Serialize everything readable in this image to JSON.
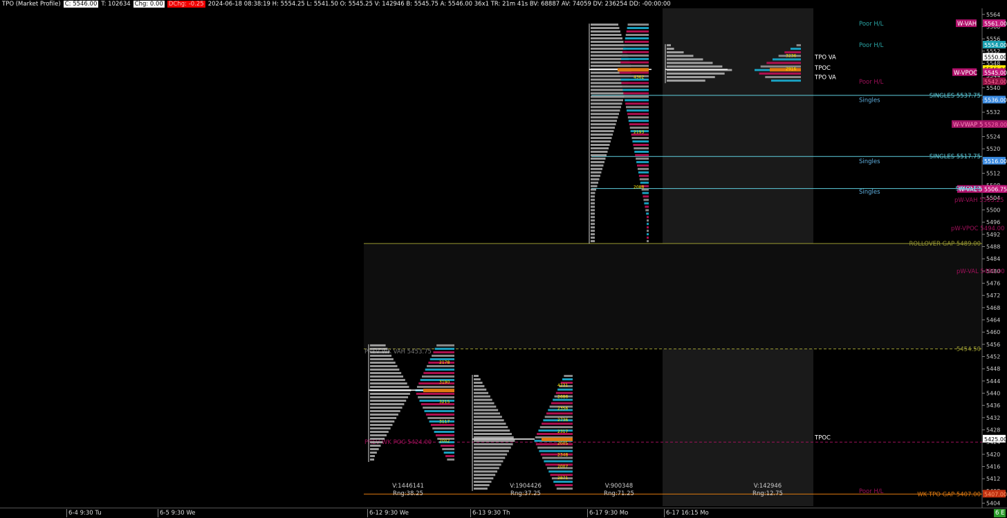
{
  "header": {
    "title": "TPO (Market Profile)",
    "close": "C: 5546.00",
    "ticks": "T: 102634",
    "chg": "Chg: 0.00",
    "dchg": "DChg: -0.25",
    "stats": "2024-06-18 08:38:19 H: 5554.25 L: 5541.50 O: 5545.25 V: 142946 B: 5545.75 A: 5546.00 36x1 TR: 21m 41s BV: 68887 AV: 74059 DV: 236254 DD: -00:00:00"
  },
  "x_axis": {
    "labels": [
      {
        "text": "6-4  9:30 Tu"
      },
      {
        "text": "6-5  9:30 We"
      },
      {
        "text": "6-12  9:30 We"
      },
      {
        "text": "6-13  9:30 Th"
      },
      {
        "text": "6-17  9:30 Mo"
      },
      {
        "text": "6-17  16:15 Mo"
      }
    ],
    "corner": "6 E"
  },
  "colors": {
    "background": "#000000",
    "cyan": "#5fd0e0",
    "magenta": "#c0187a",
    "olive": "#9a9a32",
    "orange": "#e07a10",
    "yellow": "#ffea00",
    "profile_gray": "#8a8a8a",
    "profile_teal": "#1aa0c0",
    "profile_maroon": "#b01050"
  },
  "chart_data": {
    "type": "table",
    "y_axis": {
      "range": [
        5403,
        5566
      ],
      "tick_step": 4,
      "ticks": [
        5564,
        5560,
        5556,
        5552,
        5548,
        5544,
        5540,
        5536,
        5532,
        5528,
        5524,
        5520,
        5516,
        5512,
        5508,
        5504,
        5500,
        5496,
        5492,
        5488,
        5484,
        5480,
        5476,
        5472,
        5468,
        5464,
        5460,
        5456,
        5452,
        5448,
        5444,
        5440,
        5436,
        5432,
        5428,
        5424,
        5420,
        5416,
        5412,
        5408,
        5404
      ]
    },
    "price_tags": [
      {
        "text": "5561.00",
        "price": 5561.0,
        "bg": "#c0187a",
        "fg": "#ffffff"
      },
      {
        "text": "5554.00",
        "price": 5554.0,
        "bg": "#1aa0b0",
        "fg": "#ffffff"
      },
      {
        "text": "5550.00",
        "price": 5550.0,
        "bg": "#ffffff",
        "fg": "#000000"
      },
      {
        "text": "5546.00",
        "price": 5546.0,
        "bg": "#ffea00",
        "fg": "#000000"
      },
      {
        "text": "5545.00",
        "price": 5545.0,
        "bg": "#c0187a",
        "fg": "#ffffff"
      },
      {
        "text": "5542.00",
        "price": 5542.0,
        "bg": "#8a1040",
        "fg": "#ff6a9a"
      },
      {
        "text": "5536.00",
        "price": 5536.0,
        "bg": "#3a8ae0",
        "fg": "#ffffff"
      },
      {
        "text": "5528.00",
        "price": 5528.0,
        "bg": "#a01464",
        "fg": "#ff6ab0"
      },
      {
        "text": "5516.00",
        "price": 5516.0,
        "bg": "#3a8ae0",
        "fg": "#ffffff"
      },
      {
        "text": "5506.75",
        "price": 5506.75,
        "bg": "#c0187a",
        "fg": "#ffffff"
      },
      {
        "text": "5425.00",
        "price": 5425.0,
        "bg": "#ffffff",
        "fg": "#000000"
      },
      {
        "text": "5407.00",
        "price": 5407.0,
        "bg": "#c03010",
        "fg": "#ff9a6a"
      }
    ],
    "levels": [
      {
        "label": "W-VAH",
        "value_text": "",
        "price": 5561.0,
        "color": "#e0189a",
        "label_bg": "#b0106a",
        "label_fg": "#ffffff",
        "style": "none"
      },
      {
        "label": "W-VPOC",
        "value_text": "",
        "price": 5545.0,
        "color": "#e0189a",
        "label_bg": "#b0106a",
        "label_fg": "#ffffff",
        "style": "none"
      },
      {
        "label": "W-VWAP",
        "value_text": "5528.00",
        "price": 5528.0,
        "color": "#e0189a",
        "label_bg": "#a01464",
        "label_fg": "#ff8ac0",
        "style": "none"
      },
      {
        "label": "W-VAL",
        "value_text": "5506.75",
        "price": 5506.75,
        "color": "#e0189a",
        "label_bg": "#b0106a",
        "label_fg": "#ffffff",
        "style": "none"
      },
      {
        "label": "pW-VAH",
        "value_text": "5503.25",
        "price": 5503.25,
        "color": "#a0105a",
        "label_bg": "",
        "label_fg": "#a0105a",
        "style": "none"
      },
      {
        "label": "pW-VPOC",
        "value_text": "5494.00",
        "price": 5494.0,
        "color": "#a0105a",
        "label_bg": "",
        "label_fg": "#a0105a",
        "style": "none"
      },
      {
        "label": "pW-VAL",
        "value_text": "5480.00",
        "price": 5480.0,
        "color": "#a0105a",
        "label_bg": "",
        "label_fg": "#a0105a",
        "style": "none"
      },
      {
        "label": "SINGLES",
        "value_text": "5537.75",
        "price": 5537.5,
        "color": "#5fd0e0",
        "label_bg": "",
        "label_fg": "#5fd0e0",
        "style": "solid"
      },
      {
        "label": "SINGLES",
        "value_text": "5517.75",
        "price": 5517.5,
        "color": "#5fd0e0",
        "label_bg": "",
        "label_fg": "#5fd0e0",
        "style": "solid"
      },
      {
        "label": "SINGLES",
        "value_text": "",
        "price": 5507.0,
        "color": "#5fd0e0",
        "label_bg": "",
        "label_fg": "#5fd0e0",
        "style": "solid"
      },
      {
        "label": "ROLLOVER GAP",
        "value_text": "5489.00",
        "price": 5489.0,
        "color": "#9a9a32",
        "label_bg": "",
        "label_fg": "#9a9a32",
        "style": "solid"
      },
      {
        "label": "",
        "value_text": "5454.50",
        "price": 5454.5,
        "color": "#9a9a32",
        "label_bg": "",
        "label_fg": "#9a9a32",
        "style": "dashed"
      },
      {
        "label": "WK TPO GAP",
        "value_text": "5407.00",
        "price": 5407.0,
        "color": "#e07a10",
        "label_bg": "",
        "label_fg": "#e07a10",
        "style": "solid"
      },
      {
        "label": "PREV WK VAH",
        "value_text": "5453.75",
        "price": 5453.75,
        "color": "#777777",
        "label_bg": "",
        "label_fg": "#777777",
        "style": "none"
      },
      {
        "label": "PREV WK POC",
        "value_text": "5424.00",
        "price": 5424.0,
        "color": "#a0105a",
        "label_bg": "",
        "label_fg": "#a0105a",
        "style": "dashed"
      }
    ],
    "annotations": [
      {
        "text": "Poor H/L",
        "price": 5561.0,
        "color": "#2aa5a5"
      },
      {
        "text": "Poor H/L",
        "price": 5554.0,
        "color": "#2aa5a5"
      },
      {
        "text": "Poor H/L",
        "price": 5542.0,
        "color": "#a0105a"
      },
      {
        "text": "Singles",
        "price": 5536.0,
        "color": "#5fb0e0"
      },
      {
        "text": "Singles",
        "price": 5516.0,
        "color": "#5fb0e0"
      },
      {
        "text": "Singles",
        "price": 5506.0,
        "color": "#5fb0e0"
      },
      {
        "text": "Poor H/L",
        "price": 5408.0,
        "color": "#a0105a"
      },
      {
        "text": "TPO VA",
        "price": 5550.0,
        "color": "#ffffff"
      },
      {
        "text": "TPOC",
        "price": 5546.5,
        "color": "#ffffff"
      },
      {
        "text": "TPO VA",
        "price": 5543.5,
        "color": "#ffffff"
      },
      {
        "text": "TPOC",
        "price": 5425.5,
        "color": "#ffffff"
      }
    ],
    "profiles": [
      {
        "id": "jun4",
        "volume": "V:1446141",
        "range": "Rng:38.25",
        "high": 5456.0,
        "low": 5417.5,
        "poc": 5441.0,
        "vol_labels": [
          "2178",
          "3190",
          "3215",
          "3117",
          "2002"
        ]
      },
      {
        "id": "jun13",
        "volume": "V:1904426",
        "range": "Rng:37.25",
        "high": 5446.0,
        "low": 5408.0,
        "poc": 5425.0,
        "vol_labels": [
          "4231",
          "2686",
          "2356",
          "2736",
          "2317",
          "2005",
          "2348",
          "2007",
          "2871"
        ]
      },
      {
        "id": "jun17",
        "volume": "V:900348",
        "range": "Rng:71.25",
        "high": 5561.0,
        "low": 5489.0,
        "poc": 5546.0,
        "vol_labels": [
          "4362",
          "2193",
          "2088"
        ]
      },
      {
        "id": "jun18",
        "volume": "V:142946",
        "range": "Rng:12.75",
        "high": 5554.25,
        "low": 5541.5,
        "poc": 5546.0,
        "vol_labels": [
          "3236",
          "2916"
        ]
      }
    ]
  }
}
